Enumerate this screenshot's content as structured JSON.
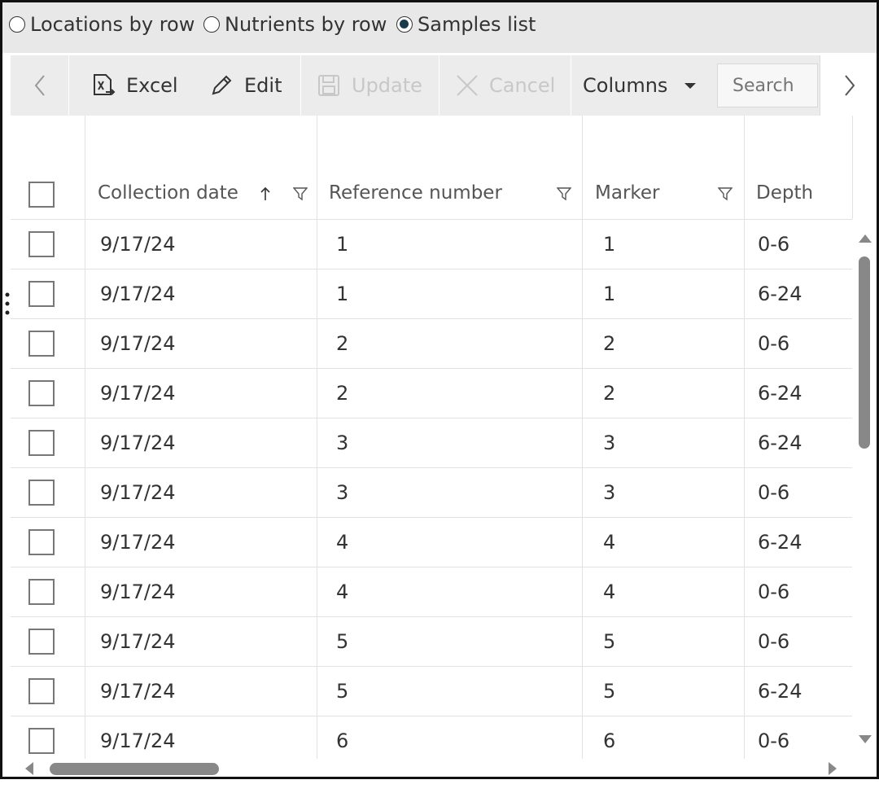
{
  "view_options": [
    {
      "label": "Locations by row",
      "checked": false
    },
    {
      "label": "Nutrients by row",
      "checked": false
    },
    {
      "label": "Samples list",
      "checked": true
    }
  ],
  "toolbar": {
    "prev_icon": "chevron-left-icon",
    "excel": {
      "label": "Excel",
      "icon": "excel-export-icon"
    },
    "edit": {
      "label": "Edit",
      "icon": "pencil-icon"
    },
    "update": {
      "label": "Update",
      "icon": "save-icon",
      "enabled": false
    },
    "cancel": {
      "label": "Cancel",
      "icon": "close-icon",
      "enabled": false
    },
    "columns": {
      "label": "Columns",
      "icon": "caret-down-icon"
    },
    "search_placeholder": "Search",
    "next_icon": "chevron-right-icon"
  },
  "columns": [
    {
      "label": "Collection date",
      "sorted": "ascending",
      "filter": true
    },
    {
      "label": "Reference number",
      "filter": true
    },
    {
      "label": "Marker",
      "filter": true
    },
    {
      "label": "Depth"
    }
  ],
  "rows": [
    [
      "9/17/24",
      "1",
      "1",
      "0-6"
    ],
    [
      "9/17/24",
      "1",
      "1",
      "6-24"
    ],
    [
      "9/17/24",
      "2",
      "2",
      "0-6"
    ],
    [
      "9/17/24",
      "2",
      "2",
      "6-24"
    ],
    [
      "9/17/24",
      "3",
      "3",
      "6-24"
    ],
    [
      "9/17/24",
      "3",
      "3",
      "0-6"
    ],
    [
      "9/17/24",
      "4",
      "4",
      "6-24"
    ],
    [
      "9/17/24",
      "4",
      "4",
      "0-6"
    ],
    [
      "9/17/24",
      "5",
      "5",
      "0-6"
    ],
    [
      "9/17/24",
      "5",
      "5",
      "6-24"
    ],
    [
      "9/17/24",
      "6",
      "6",
      "0-6"
    ]
  ],
  "colors": {
    "accent": "#1b3b4b",
    "toolbar_bg": "#ececec",
    "options_bg": "#e8e8e8",
    "scroll_thumb": "#888888"
  }
}
